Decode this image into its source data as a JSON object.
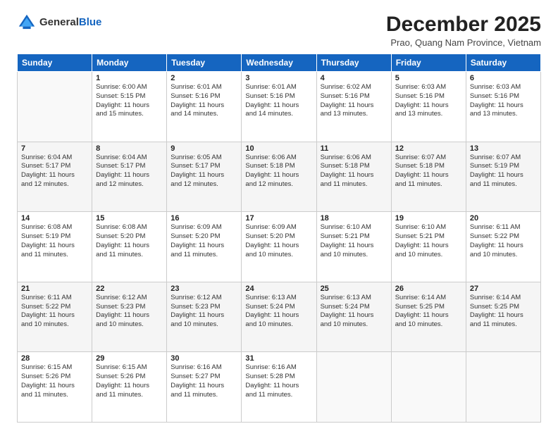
{
  "header": {
    "logo": {
      "general": "General",
      "blue": "Blue"
    },
    "title": "December 2025",
    "location": "Prao, Quang Nam Province, Vietnam"
  },
  "weekdays": [
    "Sunday",
    "Monday",
    "Tuesday",
    "Wednesday",
    "Thursday",
    "Friday",
    "Saturday"
  ],
  "weeks": [
    [
      {
        "day": "",
        "info": ""
      },
      {
        "day": "1",
        "info": "Sunrise: 6:00 AM\nSunset: 5:15 PM\nDaylight: 11 hours\nand 15 minutes."
      },
      {
        "day": "2",
        "info": "Sunrise: 6:01 AM\nSunset: 5:16 PM\nDaylight: 11 hours\nand 14 minutes."
      },
      {
        "day": "3",
        "info": "Sunrise: 6:01 AM\nSunset: 5:16 PM\nDaylight: 11 hours\nand 14 minutes."
      },
      {
        "day": "4",
        "info": "Sunrise: 6:02 AM\nSunset: 5:16 PM\nDaylight: 11 hours\nand 13 minutes."
      },
      {
        "day": "5",
        "info": "Sunrise: 6:03 AM\nSunset: 5:16 PM\nDaylight: 11 hours\nand 13 minutes."
      },
      {
        "day": "6",
        "info": "Sunrise: 6:03 AM\nSunset: 5:16 PM\nDaylight: 11 hours\nand 13 minutes."
      }
    ],
    [
      {
        "day": "7",
        "info": "Sunrise: 6:04 AM\nSunset: 5:17 PM\nDaylight: 11 hours\nand 12 minutes."
      },
      {
        "day": "8",
        "info": "Sunrise: 6:04 AM\nSunset: 5:17 PM\nDaylight: 11 hours\nand 12 minutes."
      },
      {
        "day": "9",
        "info": "Sunrise: 6:05 AM\nSunset: 5:17 PM\nDaylight: 11 hours\nand 12 minutes."
      },
      {
        "day": "10",
        "info": "Sunrise: 6:06 AM\nSunset: 5:18 PM\nDaylight: 11 hours\nand 12 minutes."
      },
      {
        "day": "11",
        "info": "Sunrise: 6:06 AM\nSunset: 5:18 PM\nDaylight: 11 hours\nand 11 minutes."
      },
      {
        "day": "12",
        "info": "Sunrise: 6:07 AM\nSunset: 5:18 PM\nDaylight: 11 hours\nand 11 minutes."
      },
      {
        "day": "13",
        "info": "Sunrise: 6:07 AM\nSunset: 5:19 PM\nDaylight: 11 hours\nand 11 minutes."
      }
    ],
    [
      {
        "day": "14",
        "info": "Sunrise: 6:08 AM\nSunset: 5:19 PM\nDaylight: 11 hours\nand 11 minutes."
      },
      {
        "day": "15",
        "info": "Sunrise: 6:08 AM\nSunset: 5:20 PM\nDaylight: 11 hours\nand 11 minutes."
      },
      {
        "day": "16",
        "info": "Sunrise: 6:09 AM\nSunset: 5:20 PM\nDaylight: 11 hours\nand 11 minutes."
      },
      {
        "day": "17",
        "info": "Sunrise: 6:09 AM\nSunset: 5:20 PM\nDaylight: 11 hours\nand 10 minutes."
      },
      {
        "day": "18",
        "info": "Sunrise: 6:10 AM\nSunset: 5:21 PM\nDaylight: 11 hours\nand 10 minutes."
      },
      {
        "day": "19",
        "info": "Sunrise: 6:10 AM\nSunset: 5:21 PM\nDaylight: 11 hours\nand 10 minutes."
      },
      {
        "day": "20",
        "info": "Sunrise: 6:11 AM\nSunset: 5:22 PM\nDaylight: 11 hours\nand 10 minutes."
      }
    ],
    [
      {
        "day": "21",
        "info": "Sunrise: 6:11 AM\nSunset: 5:22 PM\nDaylight: 11 hours\nand 10 minutes."
      },
      {
        "day": "22",
        "info": "Sunrise: 6:12 AM\nSunset: 5:23 PM\nDaylight: 11 hours\nand 10 minutes."
      },
      {
        "day": "23",
        "info": "Sunrise: 6:12 AM\nSunset: 5:23 PM\nDaylight: 11 hours\nand 10 minutes."
      },
      {
        "day": "24",
        "info": "Sunrise: 6:13 AM\nSunset: 5:24 PM\nDaylight: 11 hours\nand 10 minutes."
      },
      {
        "day": "25",
        "info": "Sunrise: 6:13 AM\nSunset: 5:24 PM\nDaylight: 11 hours\nand 10 minutes."
      },
      {
        "day": "26",
        "info": "Sunrise: 6:14 AM\nSunset: 5:25 PM\nDaylight: 11 hours\nand 10 minutes."
      },
      {
        "day": "27",
        "info": "Sunrise: 6:14 AM\nSunset: 5:25 PM\nDaylight: 11 hours\nand 11 minutes."
      }
    ],
    [
      {
        "day": "28",
        "info": "Sunrise: 6:15 AM\nSunset: 5:26 PM\nDaylight: 11 hours\nand 11 minutes."
      },
      {
        "day": "29",
        "info": "Sunrise: 6:15 AM\nSunset: 5:26 PM\nDaylight: 11 hours\nand 11 minutes."
      },
      {
        "day": "30",
        "info": "Sunrise: 6:16 AM\nSunset: 5:27 PM\nDaylight: 11 hours\nand 11 minutes."
      },
      {
        "day": "31",
        "info": "Sunrise: 6:16 AM\nSunset: 5:28 PM\nDaylight: 11 hours\nand 11 minutes."
      },
      {
        "day": "",
        "info": ""
      },
      {
        "day": "",
        "info": ""
      },
      {
        "day": "",
        "info": ""
      }
    ]
  ]
}
